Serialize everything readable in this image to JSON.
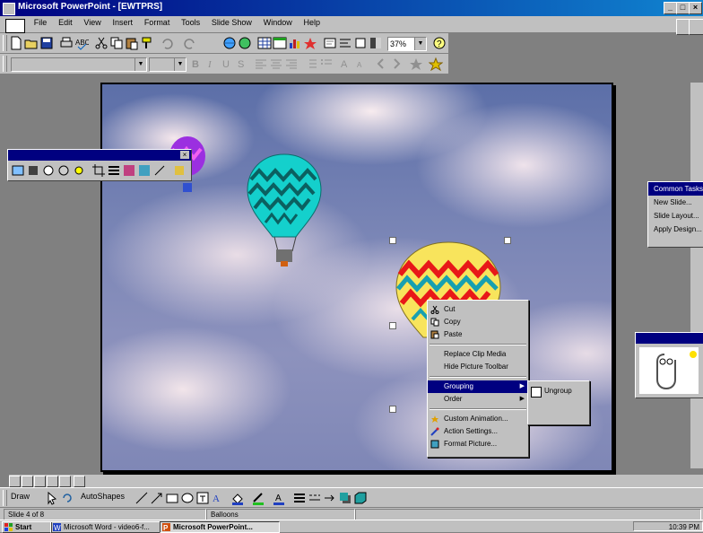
{
  "window": {
    "title": "Microsoft PowerPoint - [EWTPRS]",
    "controls": [
      "_",
      "□",
      "×"
    ]
  },
  "menu": {
    "items": [
      "File",
      "Edit",
      "View",
      "Insert",
      "Format",
      "Tools",
      "Slide Show",
      "Window",
      "Help"
    ]
  },
  "toolbar": {
    "zoom_value": "37%"
  },
  "side_panel": {
    "items": [
      "Common Tasks",
      "New Slide...",
      "Slide Layout...",
      "Apply Design..."
    ]
  },
  "context_menu": {
    "items": [
      {
        "label": "Cut",
        "icon": "scissors-icon"
      },
      {
        "label": "Copy",
        "icon": "copy-icon"
      },
      {
        "label": "Paste",
        "icon": "paste-icon"
      },
      {
        "label": "Replace Clip Media",
        "icon": ""
      },
      {
        "label": "Hide Picture Toolbar",
        "icon": ""
      },
      {
        "label": "Grouping",
        "icon": "",
        "submenu": true,
        "selected": true
      },
      {
        "label": "Order",
        "icon": "",
        "submenu": true
      },
      {
        "label": "Custom Animation...",
        "icon": "animation-icon"
      },
      {
        "label": "Action Settings...",
        "icon": "action-icon"
      },
      {
        "label": "Format Picture...",
        "icon": "format-picture-icon"
      }
    ]
  },
  "submenu": {
    "items": [
      "Ungroup"
    ]
  },
  "drawing_toolbar": {
    "draw_label": "Draw",
    "autoshapes_label": "AutoShapes"
  },
  "status": {
    "slide": "Slide 4 of 8",
    "design": "Balloons"
  },
  "taskbar": {
    "start": "Start",
    "tasks": [
      "Microsoft Word - video6-f...",
      "Microsoft PowerPoint..."
    ],
    "clock": "10:39 PM"
  },
  "colors": {
    "title_bar": "#000080",
    "menu_bg": "#c0c0c0",
    "balloon_teal": "#14d0cc",
    "balloon_yellow": "#f8e45c",
    "balloon_red": "#e81818",
    "balloon_purple": "#9b2fe0"
  }
}
